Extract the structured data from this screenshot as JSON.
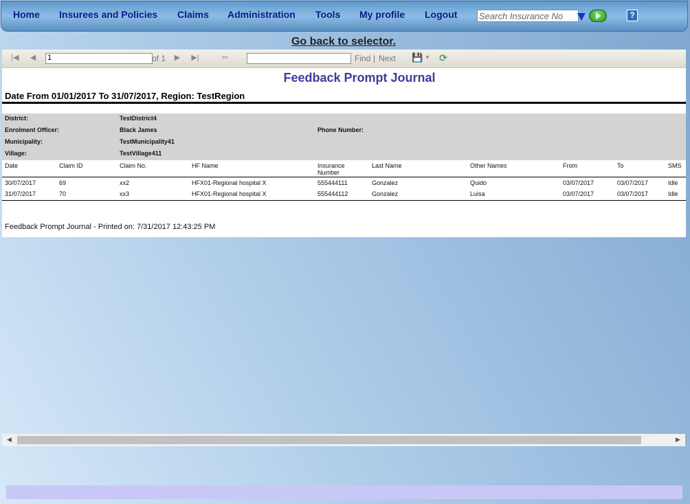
{
  "nav": {
    "items": [
      "Home",
      "Insurees and Policies",
      "Claims",
      "Administration",
      "Tools",
      "My profile",
      "Logout"
    ],
    "search_placeholder": "Search Insurance No"
  },
  "go_back": "Go back to selector.",
  "toolbar": {
    "page_value": "1",
    "of_label": "of 1",
    "find_label": "Find",
    "separator": "|",
    "next_label": "Next"
  },
  "report": {
    "title": "Feedback Prompt Journal",
    "subtitle": "Date From 01/01/2017 To 31/07/2017, Region: TestRegion",
    "info": {
      "district_label": "District:",
      "district_value": "TestDistrict4",
      "officer_label": "Enrolment Officer:",
      "officer_value": "Black James",
      "phone_label": "Phone Number:",
      "municipality_label": "Municipality:",
      "municipality_value": "TestMunicipality41",
      "village_label": "Village:",
      "village_value": "TestVillage411"
    },
    "columns": [
      "Date",
      "Claim ID",
      "Claim No.",
      "HF Name",
      "Insurance",
      "Number",
      "Last Name",
      "Other Names",
      "From",
      "To",
      "SMS"
    ],
    "rows": [
      [
        "30/07/2017",
        "69",
        "xx2",
        "HFX01-Regional hospital X",
        "555444111",
        "Gonzalez",
        "Quido",
        "03/07/2017",
        "03/07/2017",
        "Idle"
      ],
      [
        "31/07/2017",
        "70",
        "xx3",
        "HFX01-Regional hospital X",
        "555444112",
        "Gonzalez",
        "Luisa",
        "03/07/2017",
        "03/07/2017",
        "Idle"
      ]
    ],
    "footer": "Feedback Prompt Journal - Printed on: 7/31/2017 12:43:25 PM"
  }
}
